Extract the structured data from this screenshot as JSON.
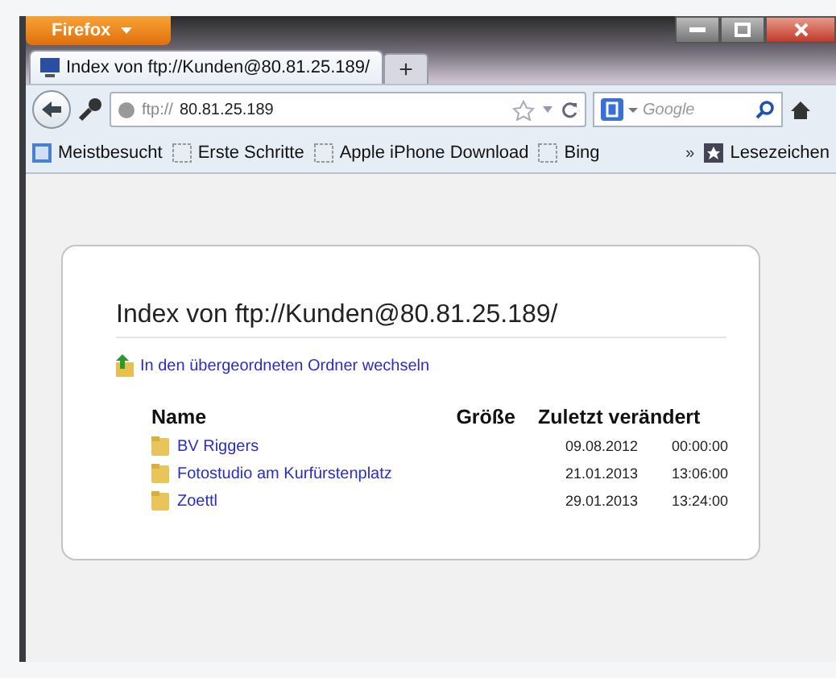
{
  "app_menu": {
    "label": "Firefox"
  },
  "tabs": [
    {
      "title": "Index von ftp://Kunden@80.81.25.189/",
      "selected": true
    }
  ],
  "new_tab": {
    "label": "+"
  },
  "address_bar": {
    "scheme": "ftp://",
    "host": "80.81.25.189"
  },
  "search": {
    "placeholder": "Google"
  },
  "bookmarks": [
    {
      "label": "Meistbesucht",
      "kind": "smart"
    },
    {
      "label": "Erste Schritte",
      "kind": "page"
    },
    {
      "label": "Apple iPhone Download",
      "kind": "page"
    },
    {
      "label": "Bing",
      "kind": "page"
    }
  ],
  "bookmarks_overflow": {
    "label": "»"
  },
  "bookmarks_menu": {
    "label": "Lesezeichen"
  },
  "page": {
    "heading": "Index von ftp://Kunden@80.81.25.189/",
    "parent_link": "In den übergeordneten Ordner wechseln",
    "columns": [
      "Name",
      "Größe",
      "Zuletzt verändert"
    ],
    "rows": [
      {
        "name": "BV Riggers",
        "date": "09.08.2012",
        "time": "00:00:00"
      },
      {
        "name": "Fotostudio am Kurfürstenplatz",
        "date": "21.01.2013",
        "time": "13:06:00"
      },
      {
        "name": "Zoettl",
        "date": "29.01.2013",
        "time": "13:24:00"
      }
    ]
  }
}
